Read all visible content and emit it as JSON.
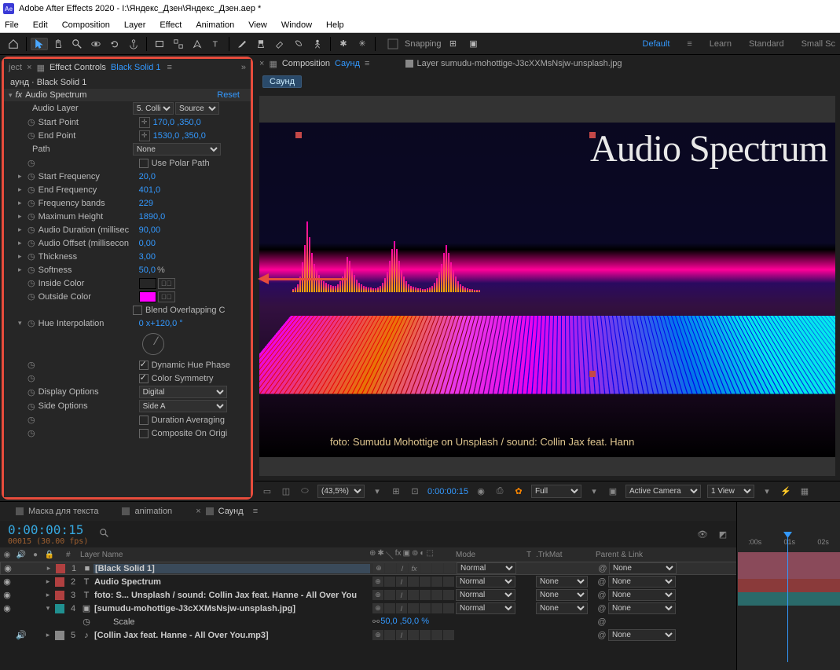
{
  "title": "Adobe After Effects 2020 - I:\\Яндекс_Дзен\\Яндекс_Дзен.aep *",
  "menu": [
    "File",
    "Edit",
    "Composition",
    "Layer",
    "Effect",
    "Animation",
    "View",
    "Window",
    "Help"
  ],
  "toolbar": {
    "snapping": "Snapping"
  },
  "workspaces": {
    "default": "Default",
    "learn": "Learn",
    "standard": "Standard",
    "small": "Small Sc"
  },
  "ec": {
    "tab_prefix": "ject",
    "tab_label": "Effect Controls",
    "tab_layer": "Black Solid 1",
    "header": "аунд · Black Solid 1",
    "fx_name": "Audio Spectrum",
    "reset": "Reset",
    "props": {
      "audio_layer_label": "Audio Layer",
      "audio_layer_val": "5. Collii",
      "audio_layer_mode": "Source",
      "start_point_label": "Start Point",
      "start_point_val": "170,0 ,350,0",
      "end_point_label": "End Point",
      "end_point_val": "1530,0 ,350,0",
      "path_label": "Path",
      "path_val": "None",
      "use_polar_label": "Use Polar Path",
      "start_freq_label": "Start Frequency",
      "start_freq_val": "20,0",
      "end_freq_label": "End Frequency",
      "end_freq_val": "401,0",
      "freq_bands_label": "Frequency bands",
      "freq_bands_val": "229",
      "max_height_label": "Maximum Height",
      "max_height_val": "1890,0",
      "audio_dur_label": "Audio Duration (millisec",
      "audio_dur_val": "90,00",
      "audio_off_label": "Audio Offset (millisecon",
      "audio_off_val": "0,00",
      "thickness_label": "Thickness",
      "thickness_val": "3,00",
      "softness_label": "Softness",
      "softness_val": "50,0",
      "inside_color_label": "Inside Color",
      "inside_color": "#ff00ff",
      "outside_color_label": "Outside Color",
      "outside_color": "#ff00ff",
      "blend_label": "Blend Overlapping C",
      "hue_label": "Hue Interpolation",
      "hue_val": "0 x+120,0 °",
      "dyn_hue_label": "Dynamic Hue Phase",
      "color_sym_label": "Color Symmetry",
      "display_opt_label": "Display Options",
      "display_opt_val": "Digital",
      "side_opt_label": "Side Options",
      "side_opt_val": "Side A",
      "dur_avg_label": "Duration Averaging",
      "comp_orig_label": "Composite On Origi"
    }
  },
  "comp": {
    "tab_label": "Composition",
    "comp_name": "Саунд",
    "layer_tab": "Layer sumudu-mohottige-J3cXXMsNsjw-unsplash.jpg",
    "chip": "Саунд",
    "preview_title": "Audio Spectrum",
    "preview_caption": "foto: Sumudu Mohottige on Unsplash / sound: Collin Jax feat. Hann"
  },
  "viewctrl": {
    "mag": "(43,5%)",
    "tc": "0:00:00:15",
    "full": "Full",
    "camera": "Active Camera",
    "view": "1 View"
  },
  "tl": {
    "tabs": {
      "mask": "Маска для текста",
      "anim": "animation",
      "sound": "Саунд"
    },
    "tc": "0:00:00:15",
    "tc_sub": "00015 (30.00 fps)",
    "cols": {
      "num": "#",
      "name": "Layer Name",
      "mode": "Mode",
      "t": "T",
      "trk": ".TrkMat",
      "parent": "Parent & Link"
    },
    "ruler": {
      "t0": ":00s",
      "t1": "01s",
      "t2": "02s"
    },
    "layers": [
      {
        "n": "1",
        "color": "#b04040",
        "kind": "solid",
        "name": "[Black Solid 1]",
        "mode": "Normal",
        "trk": "",
        "parent": "None",
        "twisty": ">",
        "sel": true,
        "fx": true,
        "bar": "pink"
      },
      {
        "n": "2",
        "color": "#b04040",
        "kind": "T",
        "name": "Audio Spectrum",
        "mode": "Normal",
        "trk": "None",
        "parent": "None",
        "twisty": ">",
        "bar": "pink"
      },
      {
        "n": "3",
        "color": "#b04040",
        "kind": "T",
        "name": "foto: S... Unsplash / sound: Collin Jax feat. Hanne - All Over You",
        "mode": "Normal",
        "trk": "None",
        "parent": "None",
        "twisty": ">",
        "bar": "red"
      },
      {
        "n": "4",
        "color": "#209090",
        "kind": "img",
        "name": "[sumudu-mohottige-J3cXXMsNsjw-unsplash.jpg]",
        "mode": "Normal",
        "trk": "None",
        "parent": "None",
        "twisty": "v",
        "bar": "teal"
      }
    ],
    "scale_label": "Scale",
    "scale_val": "50,0 ,50,0 %",
    "layer5": {
      "n": "5",
      "color": "#888",
      "kind": "aud",
      "name": "[Collin Jax feat. Hanne - All Over You.mp3]",
      "parent": "None"
    }
  }
}
